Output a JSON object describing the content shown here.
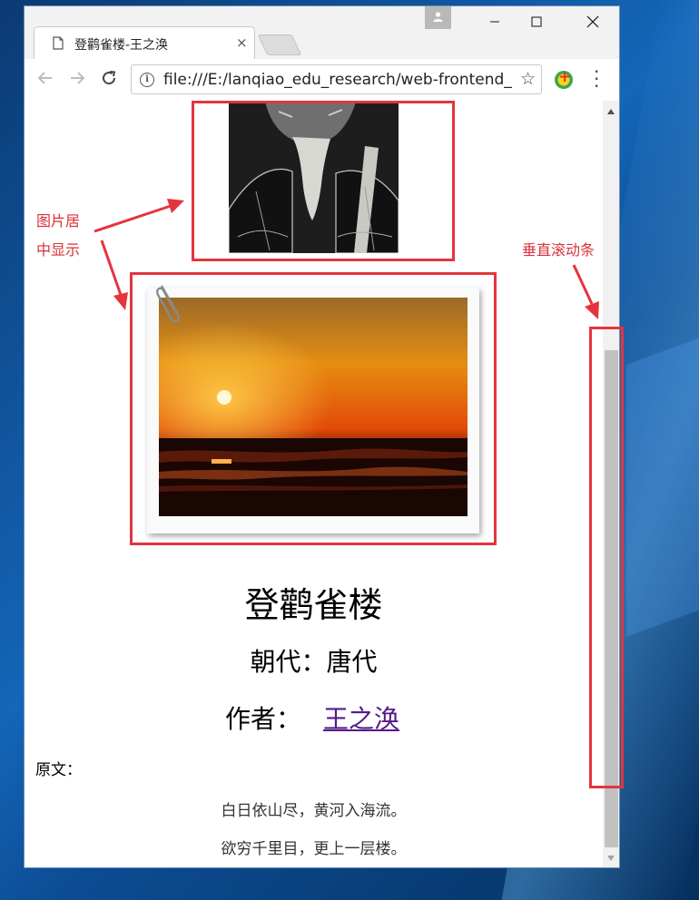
{
  "browser": {
    "tab_title": "登鹳雀楼-王之涣",
    "tab_close": "×",
    "url": "file:///E:/lanqiao_edu_research/web-frontend_",
    "back_icon": "arrow-left-icon",
    "forward_icon": "arrow-right-icon",
    "reload_icon": "reload-icon"
  },
  "page": {
    "title": "登鹳雀楼",
    "dynasty": "朝代：唐代",
    "author_label": "作者：",
    "author_name": "王之涣",
    "original_label": "原文：",
    "lines": [
      "白日依山尽，黄河入海流。",
      "欲穷千里目，更上一层楼。"
    ]
  },
  "annotations": {
    "image_centered_line1": "图片居",
    "image_centered_line2": "中显示",
    "scrollbar_label": "垂直滚动条",
    "color": "#e5343d"
  },
  "scrollbar": {
    "position": 0.33
  }
}
